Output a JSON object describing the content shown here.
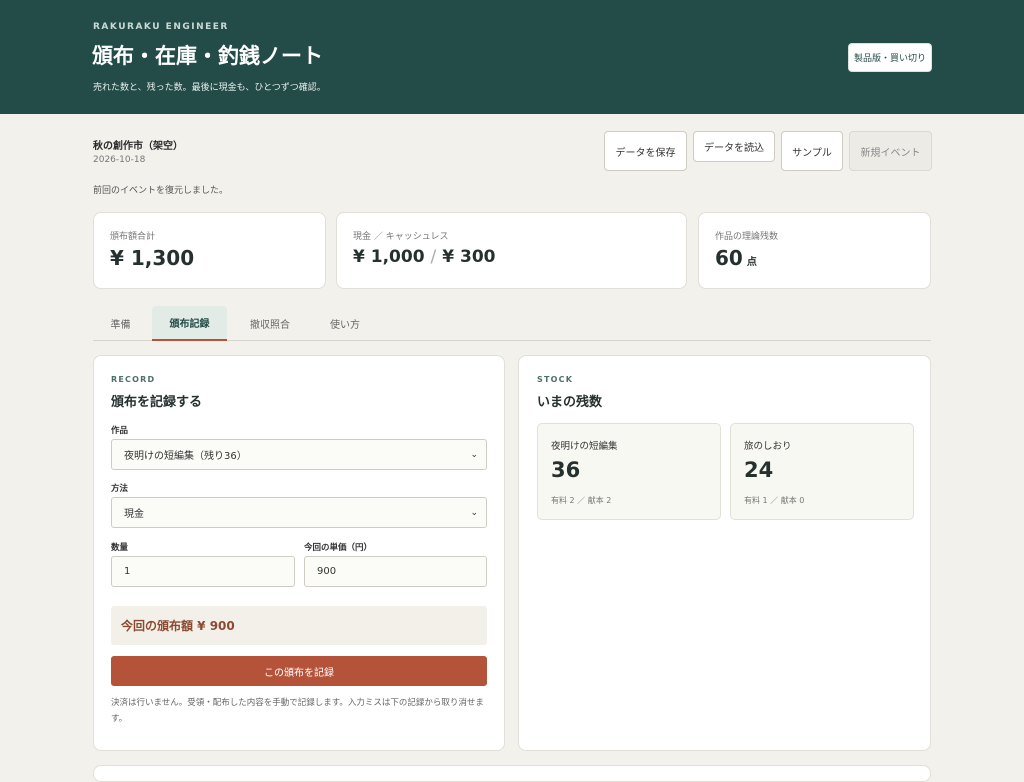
{
  "header": {
    "brand": "RAKURAKU ENGINEER",
    "title": "頒布・在庫・釣銭ノート",
    "subtitle": "売れた数と、残った数。最後に現金も、ひとつずつ確認。",
    "pro_button": "製品版・買い切り"
  },
  "event": {
    "name": "秋の創作市（架空）",
    "date": "2026-10-18",
    "status": "前回のイベントを復元しました。"
  },
  "toolbar": {
    "save": "データを保存",
    "load": "データを読込",
    "sample": "サンプル",
    "new_event": "新規イベント"
  },
  "summary": {
    "total_label": "頒布額合計",
    "total_value": "¥ 1,300",
    "split_label": "現金 ／ キャッシュレス",
    "cash_value": "¥ 1,000",
    "cashless_value": "¥ 300",
    "stock_label": "作品の理論残数",
    "stock_value": "60",
    "stock_unit": "点"
  },
  "tabs": [
    {
      "label": "準備"
    },
    {
      "label": "頒布記録"
    },
    {
      "label": "撤収照合"
    },
    {
      "label": "使い方"
    }
  ],
  "record": {
    "kicker": "RECORD",
    "title": "頒布を記録する",
    "item_label": "作品",
    "item_value": "夜明けの短編集（残り36）",
    "method_label": "方法",
    "method_value": "現金",
    "qty_label": "数量",
    "qty_value": "1",
    "price_label": "今回の単価（円）",
    "price_value": "900",
    "total_text": "今回の頒布額 ¥ 900",
    "submit": "この頒布を記録",
    "note": "決済は行いません。受領・配布した内容を手動で記録します。入力ミスは下の記録から取り消せます。"
  },
  "stock": {
    "kicker": "STOCK",
    "title": "いまの残数",
    "items": [
      {
        "name": "夜明けの短編集",
        "count": "36",
        "detail": "有料 2 ／ 献本 2"
      },
      {
        "name": "旅のしおり",
        "count": "24",
        "detail": "有料 1 ／ 献本 0"
      }
    ]
  }
}
